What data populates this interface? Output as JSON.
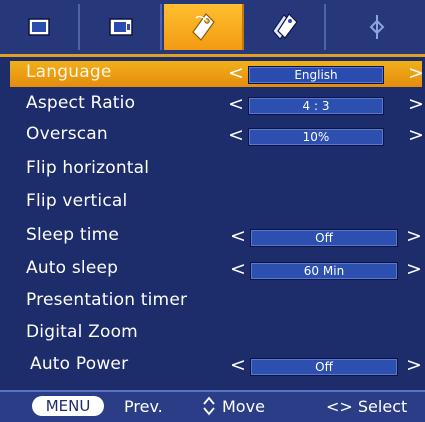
{
  "tabs": [
    {
      "icon": "picture-icon",
      "active": false
    },
    {
      "icon": "screen-icon",
      "active": false
    },
    {
      "icon": "option-tag-icon",
      "active": true
    },
    {
      "icon": "option2-tag-icon",
      "active": false
    },
    {
      "icon": "input-icon",
      "active": false
    }
  ],
  "menu": {
    "language": {
      "label": "Language",
      "value": "English"
    },
    "aspect_ratio": {
      "label": "Aspect Ratio",
      "value": "4 : 3"
    },
    "overscan": {
      "label": "Overscan",
      "value": "10%"
    },
    "flip_horizontal": {
      "label": "Flip horizontal"
    },
    "flip_vertical": {
      "label": "Flip vertical"
    },
    "sleep_time": {
      "label": "Sleep time",
      "value": "Off"
    },
    "auto_sleep": {
      "label": "Auto sleep",
      "value": "60 Min"
    },
    "presentation_timer": {
      "label": "Presentation timer"
    },
    "digital_zoom": {
      "label": "Digital Zoom"
    },
    "auto_power": {
      "label": "Auto Power",
      "value": "Off"
    },
    "arrow_left": "<",
    "arrow_right": ">"
  },
  "footer": {
    "menu_key": "MENU",
    "prev_label": "Prev.",
    "move_label": "Move",
    "select_label": "<> Select"
  },
  "colors": {
    "background": "#1d2c6a",
    "highlight": "#f2b01b",
    "value_box": "#2c4fb0"
  }
}
